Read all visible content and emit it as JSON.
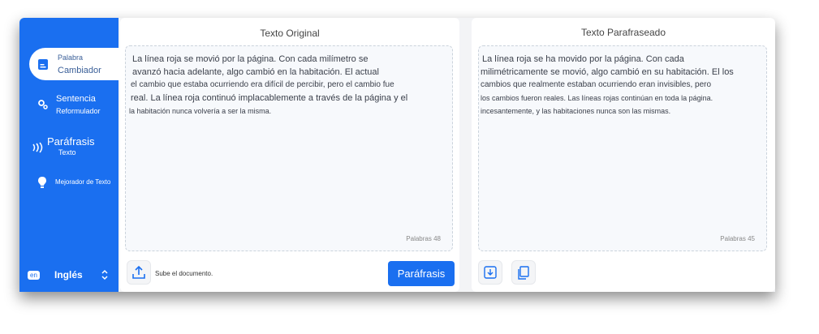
{
  "colors": {
    "sidebar": "#1a6ff0",
    "accent": "#1a6ff0",
    "active_text": "#2a5ba8"
  },
  "sidebar": {
    "items": [
      {
        "line1": "Palabra",
        "line2": "Cambiador",
        "icon": "document-icon",
        "active": true
      },
      {
        "line1": "Sentencia",
        "line2": "Reformulador",
        "icon": "gears-icon",
        "active": false
      },
      {
        "line1": "Paráfrasis",
        "line2": "Texto",
        "icon": "signal-waves-icon",
        "active": false
      },
      {
        "line1": "Mejorador de Texto",
        "line2": "",
        "icon": "lightbulb-icon",
        "active": false
      }
    ],
    "language": {
      "code": "en",
      "label": "Inglés",
      "icon": "chevron-updown-icon"
    }
  },
  "original": {
    "title": "Texto Original",
    "lines": [
      "La línea roja se movió por la página. Con cada milímetro se",
      "avanzó hacia adelante, algo cambió en la habitación. El actual",
      "el cambio que estaba ocurriendo era difícil de percibir, pero el cambio fue",
      "real. La línea roja continuó implacablemente a través de la página y el",
      "la habitación nunca volvería a ser la misma."
    ],
    "count": "Palabras 48",
    "upload_label": "Sube el documento.",
    "button_label": "Paráfrasis"
  },
  "paraphrased": {
    "title": "Texto Parafraseado",
    "lines": [
      "La línea roja se ha movido por la página. Con cada",
      "milimétricamente se movió, algo cambió en su habitación. El los",
      "cambios que realmente estaban ocurriendo eran invisibles, pero",
      "los cambios fueron reales. Las líneas rojas continúan en toda la página.",
      "incesantemente, y las habitaciones nunca son las mismas."
    ],
    "count": "Palabras 45"
  }
}
